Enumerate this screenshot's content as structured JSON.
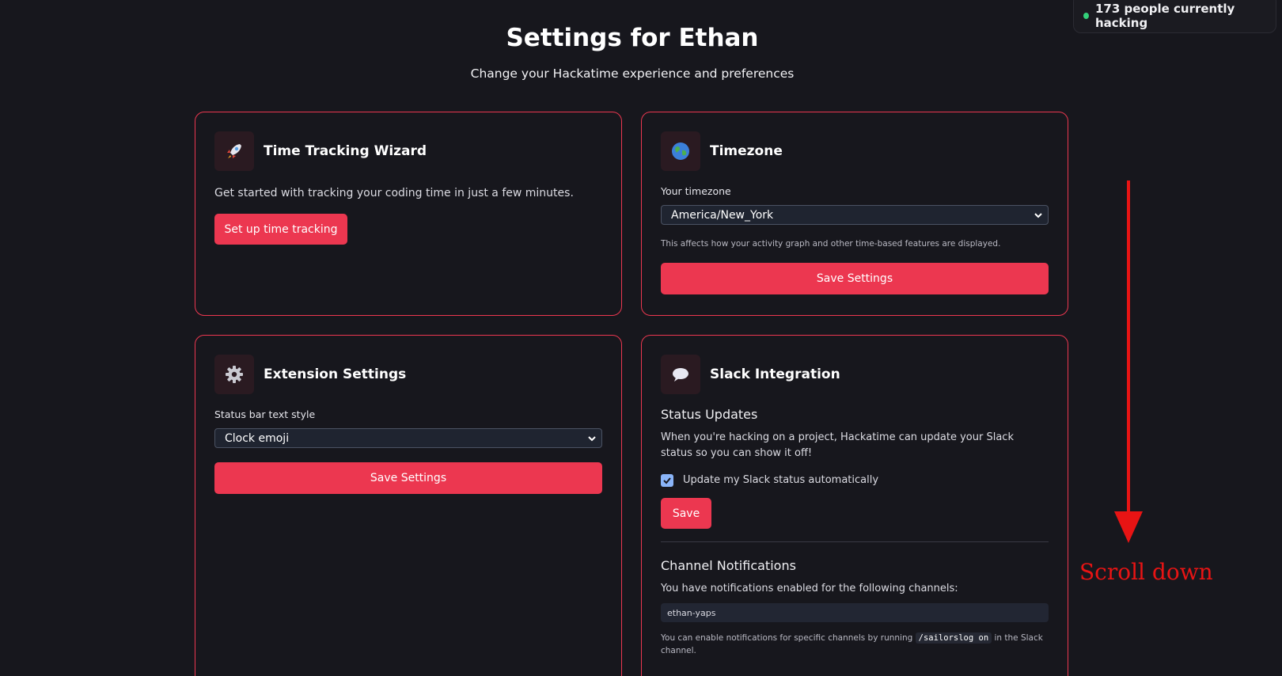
{
  "presence": {
    "text": "173 people currently hacking"
  },
  "header": {
    "title": "Settings for Ethan",
    "subtitle": "Change your Hackatime experience and preferences"
  },
  "wizard": {
    "icon": "rocket-icon",
    "title": "Time Tracking Wizard",
    "description": "Get started with tracking your coding time in just a few minutes.",
    "button_label": "Set up time tracking"
  },
  "timezone": {
    "icon": "globe-icon",
    "title": "Timezone",
    "field_label": "Your timezone",
    "selected": "America/New_York",
    "hint": "This affects how your activity graph and other time-based features are displayed.",
    "button_label": "Save Settings"
  },
  "extension": {
    "icon": "gear-icon",
    "title": "Extension Settings",
    "field_label": "Status bar text style",
    "selected": "Clock emoji",
    "button_label": "Save Settings"
  },
  "slack": {
    "icon": "speech-bubble-icon",
    "title": "Slack Integration",
    "status_heading": "Status Updates",
    "status_description": "When you're hacking on a project, Hackatime can update your Slack status so you can show it off!",
    "checkbox_label": "Update my Slack status automatically",
    "checkbox_checked": true,
    "save_label": "Save",
    "channel_heading": "Channel Notifications",
    "channel_description": "You have notifications enabled for the following channels:",
    "channels": [
      "ethan-yaps"
    ],
    "hint_before": "You can enable notifications for specific channels by running",
    "hint_command": "/sailorslog on",
    "hint_after": "in the Slack channel."
  },
  "annotation": {
    "text": "Scroll down",
    "color": "#e81414"
  },
  "colors": {
    "accent": "#ec3750",
    "background": "#17171d",
    "online": "#33d17a"
  }
}
